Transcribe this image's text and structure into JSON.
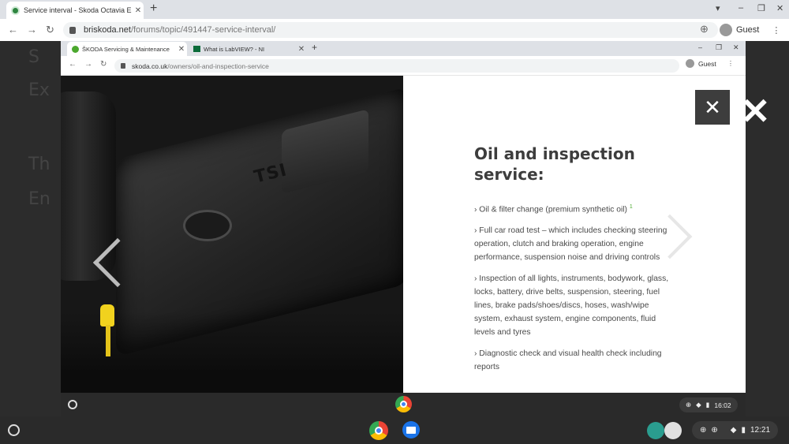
{
  "outer_browser": {
    "tab_title": "Service interval - Skoda Octavia E",
    "url_domain": "briskoda.net",
    "url_path": "/forums/topic/491447-service-interval/",
    "profile": "Guest"
  },
  "inner_browser": {
    "tabs": [
      {
        "label": "ŠKODA Servicing & Maintenance"
      },
      {
        "label": "What is LabVIEW? - NI"
      }
    ],
    "url_domain": "skoda.co.uk",
    "url_path": "/owners/oil-and-inspection-service",
    "profile": "Guest"
  },
  "panel": {
    "heading_line1": "Oil and inspection",
    "heading_line2": "service:",
    "items": [
      {
        "text": "› Oil & filter change (premium synthetic oil)",
        "sup": "1"
      },
      {
        "text": "› Full car road test – which includes checking steering operation, clutch and braking operation, engine performance, suspension noise and driving controls"
      },
      {
        "text": "› Inspection of all lights, instruments, bodywork, glass, locks, battery, drive belts, suspension, steering, fuel lines, brake pads/shoes/discs, hoses, wash/wipe system, exhaust system, engine components, fluid levels and tyres"
      },
      {
        "text": "› Diagnostic check and visual health check including reports"
      }
    ]
  },
  "engine_badge": "TSI",
  "inner_shelf": {
    "time": "16:02"
  },
  "outer_shelf": {
    "time": "12:21"
  },
  "background_letters": [
    "S",
    "Ex",
    "Th",
    "En"
  ],
  "colors": {
    "skoda_green": "#4ba82e",
    "close_button": "#3d3d3d",
    "heading": "#3d3d3d"
  }
}
